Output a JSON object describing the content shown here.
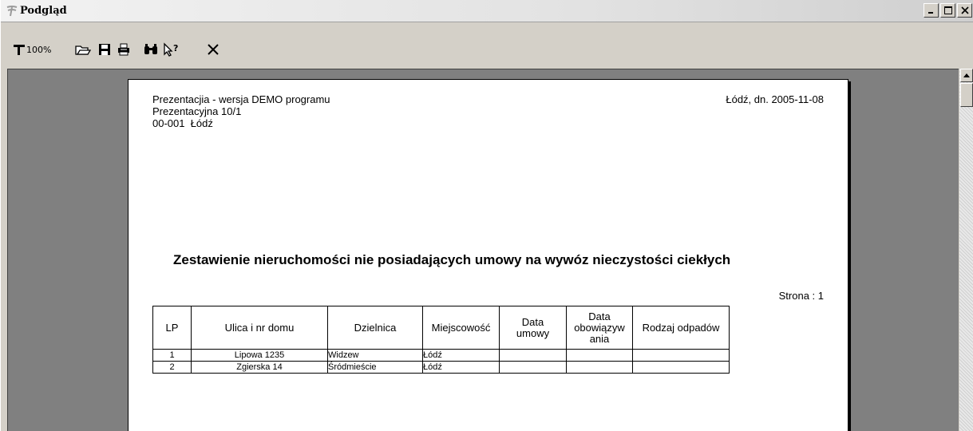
{
  "window": {
    "title": "Podgląd"
  },
  "toolbar": {
    "zoom_label": "100%",
    "items": [
      {
        "icon": "page-width-icon"
      },
      {
        "icon": "open-folder-icon"
      },
      {
        "icon": "save-icon"
      },
      {
        "icon": "print-icon"
      },
      {
        "icon": "find-icon"
      },
      {
        "icon": "help-pointer-icon"
      },
      {
        "icon": "close-icon"
      }
    ]
  },
  "document": {
    "sender_lines": [
      "Prezentacjia - wersja DEMO programu",
      "Prezentacyjna 10/1",
      "00-001  Łódź"
    ],
    "place_date": "Łódź, dn. 2005-11-08",
    "title": "Zestawienie nieruchomości nie posiadających umowy na wywóz nieczystości ciekłych",
    "page_label": "Strona : 1",
    "table": {
      "headers": [
        "LP",
        "Ulica i nr domu",
        "Dzielnica",
        "Miejscowość",
        "Data umowy",
        "Data obowiązyw ania",
        "Rodzaj odpadów"
      ],
      "rows": [
        [
          "1",
          "Lipowa 1235",
          "Widzew",
          "Łódź",
          "",
          "",
          ""
        ],
        [
          "2",
          "Zgierska 14",
          "Śródmieście",
          "Łódź",
          "",
          "",
          ""
        ]
      ]
    }
  },
  "colors": {
    "workspace": "#808080",
    "chrome": "#d4d0c8",
    "paper": "#ffffff"
  }
}
